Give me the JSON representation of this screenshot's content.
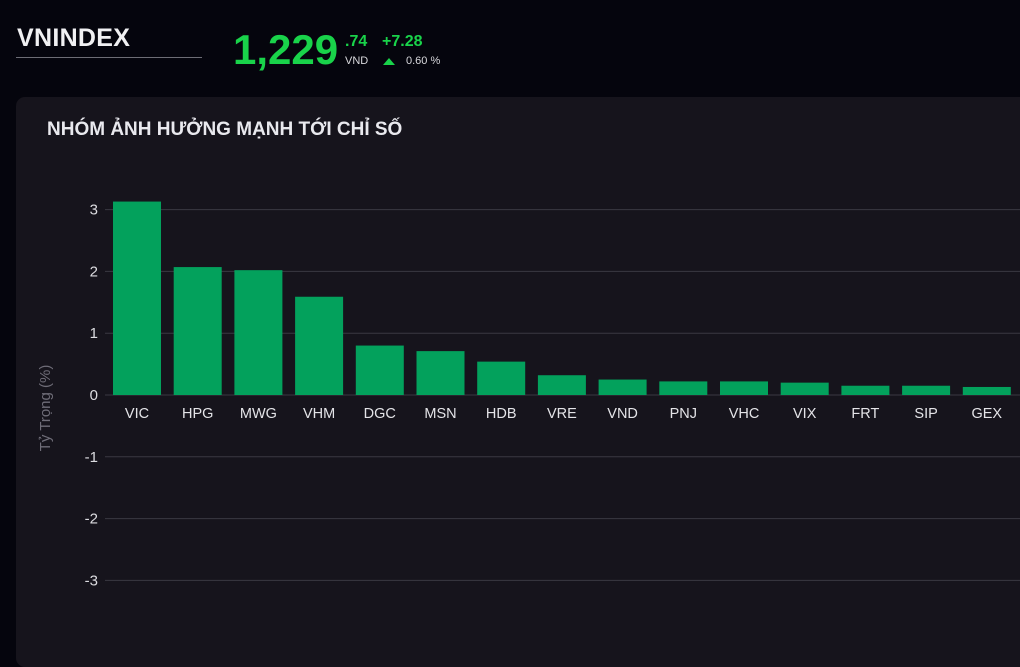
{
  "header": {
    "index_name": "VNINDEX",
    "price_int": "1,229",
    "price_dec": ".74",
    "currency": "VND",
    "change": "+7.28",
    "change_pct": "0.60 %",
    "trend_icon": "triangle-up-icon",
    "accent_color": "#19d34a"
  },
  "panel": {
    "title": "NHÓM ẢNH HƯỞNG MẠNH TỚI CHỈ SỐ"
  },
  "chart_data": {
    "type": "bar",
    "ylabel": "Tỷ Trọng (%)",
    "xlabel": "",
    "ylim": [
      -3.5,
      3.1
    ],
    "yticks": [
      3,
      2,
      1,
      0,
      -1,
      -2,
      -3
    ],
    "grid": true,
    "bar_color": "#03a15c",
    "categories": [
      "VIC",
      "HPG",
      "MWG",
      "VHM",
      "DGC",
      "MSN",
      "HDB",
      "VRE",
      "VND",
      "PNJ",
      "VHC",
      "VIX",
      "FRT",
      "SIP",
      "GEX"
    ],
    "values": [
      3.13,
      2.07,
      2.02,
      1.59,
      0.8,
      0.71,
      0.54,
      0.32,
      0.25,
      0.22,
      0.22,
      0.2,
      0.15,
      0.15,
      0.13
    ]
  }
}
